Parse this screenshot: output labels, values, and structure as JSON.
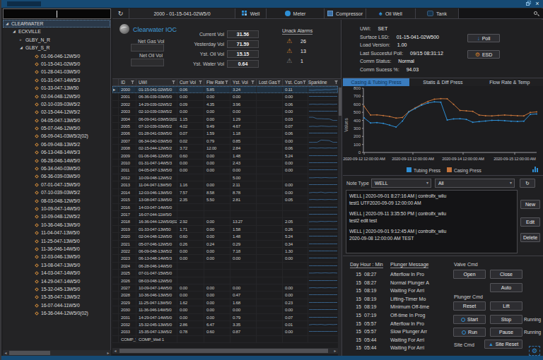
{
  "titlebar": {
    "restore": "restore",
    "close": "×"
  },
  "toolbar": {
    "well_selector": "2000 - 01-15-041-02W5/0",
    "tabs": [
      {
        "label": "Well",
        "icon": "grid-icon"
      },
      {
        "label": "Meter",
        "icon": "circle-icon"
      },
      {
        "label": "Compressor",
        "icon": "compressor-icon"
      },
      {
        "label": "Oil Well",
        "icon": "spade-icon"
      },
      {
        "label": "Tank",
        "icon": "tank-icon"
      }
    ]
  },
  "sidebar": {
    "filter_value": "",
    "root": "CLEARWATER",
    "region": "ECKVILLE",
    "groups": [
      {
        "label": "GLBY_N_R",
        "expanded": false
      },
      {
        "label": "GLBY_S_R",
        "expanded": true
      }
    ],
    "wells": [
      "01-06-046-12W5/0",
      "01-15-041-02W5/0",
      "01-28-041-03W5/0",
      "01-31-047-14W5/3",
      "01-33-047-13W50",
      "02-04-048-12W5/0",
      "02-10-039-03W5/2",
      "02-15-044-12W5/2",
      "04-05-047-13W5/0",
      "05-07-046-12W5/0",
      "06-09-041-03W5/2(02)",
      "06-09-048-13W5/2",
      "06-13-048-14W5/3",
      "06-28-046-14W5/0",
      "06-34-040-03W5/0",
      "06-36-039-03W5/0",
      "07-01-047-15W5/0",
      "07-10-039-03W5/2",
      "08-03-048-12W5/0",
      "10-09-047-14W5/0",
      "10-09-048-12W5/2",
      "10-36-046-13W5/0",
      "11-04-047-13W5/0",
      "11-25-047-13W5/0",
      "11-36-046-14W5/0",
      "12-03-046-13W5/0",
      "13-08-047-13W5/0",
      "14-03-047-14W5/0",
      "14-29-047-14W5/0",
      "15-32-045-13W5/0",
      "15-35-047-13W5/2",
      "16-07-044-11W5/0",
      "16-36-044-12W5/0(02)"
    ]
  },
  "ioc_panel": {
    "brand": "Clearwater IOC",
    "left_fields": [
      {
        "label": "Net Gas Vol",
        "value": ""
      },
      {
        "label": "Net Oil Vol",
        "value": ""
      }
    ],
    "right_fields": [
      {
        "label": "Current Vol",
        "value": "31.56"
      },
      {
        "label": "Yesterday Vol",
        "value": "71.59"
      },
      {
        "label": "Yst. Oil Vol",
        "value": "15.15"
      },
      {
        "label": "Yst. Water Vol",
        "value": "0.64"
      }
    ],
    "alarms": {
      "title": "Unack Alarms",
      "rows": [
        {
          "severity": "high",
          "count": "26"
        },
        {
          "severity": "high",
          "count": "13"
        },
        {
          "severity": "low",
          "count": "1"
        }
      ]
    }
  },
  "well_info": {
    "rows": [
      {
        "label": "UWI:",
        "value": "SET"
      },
      {
        "label": "Surface LSD:",
        "value": "01-15-041-02W500"
      },
      {
        "label": "Load Version:",
        "value": "1.00"
      },
      {
        "label": "Last Succesful Poll:",
        "value": "09/15 08:31:12"
      },
      {
        "label": "Comm Status:",
        "value": "Normal"
      },
      {
        "label": "Comm Sucess %:",
        "value": "94.03"
      }
    ],
    "poll_label": "Poll",
    "esd_label": "ESD"
  },
  "grid": {
    "columns": [
      "",
      "ID",
      "UWI",
      "Curr Vol",
      "Flw Rate",
      "Yst. Vol",
      "Lost Gas",
      "Yst. Cond",
      "Sparkline"
    ],
    "rows": [
      {
        "id": "2000",
        "uwi": "01-15-041-02W5/0",
        "curr": "0.06",
        "flw": "5.85",
        "yst": "3.24",
        "lost": "",
        "cond": "0.11",
        "selected": true,
        "spark": [
          0.35,
          0.3,
          0.4,
          0.35,
          0.45,
          0.4,
          0.5,
          0.55
        ]
      },
      {
        "id": "2001",
        "uwi": "06-36-039-03W5/0",
        "curr": "0.00",
        "flw": "0.00",
        "yst": "0.00",
        "lost": "",
        "cond": "0.00",
        "spark": [
          0.5,
          0.5,
          0.5,
          0.5,
          0.5,
          0.5,
          0.5,
          0.5
        ]
      },
      {
        "id": "2002",
        "uwi": "14-29-039-02W5/2",
        "curr": "0.09",
        "flw": "4.35",
        "yst": "3.96",
        "lost": "",
        "cond": "0.06",
        "spark": [
          0.45,
          0.5,
          0.45,
          0.5,
          0.45,
          0.5,
          0.45,
          0.5
        ]
      },
      {
        "id": "2003",
        "uwi": "02-10-039-03W5/2",
        "curr": "0.00",
        "flw": "0.00",
        "yst": "0.00",
        "lost": "",
        "cond": "0.00",
        "spark": [
          0.5,
          0.5,
          0.5,
          0.5,
          0.5,
          0.5,
          0.5,
          0.5
        ]
      },
      {
        "id": "2004",
        "uwi": "06-09-041-03W5/2(02)",
        "curr": "1.15",
        "flw": "0.00",
        "yst": "1.29",
        "lost": "",
        "cond": "0.03",
        "spark": [
          0.85,
          0.85,
          0.55,
          0.55,
          0.5,
          0.5,
          0.2,
          0.2
        ]
      },
      {
        "id": "2005",
        "uwi": "07-10-039-03W5/2",
        "curr": "4.02",
        "flw": "9.49",
        "yst": "4.67",
        "lost": "",
        "cond": "0.07",
        "spark": [
          0.4,
          0.45,
          0.4,
          0.5,
          0.45,
          0.4,
          0.45,
          0.4
        ]
      },
      {
        "id": "2006",
        "uwi": "01-28-041-03W5/0",
        "curr": "0.07",
        "flw": "1.59",
        "yst": "1.18",
        "lost": "",
        "cond": "0.06",
        "spark": [
          0.5,
          0.5,
          0.5,
          0.5,
          0.5,
          0.5,
          0.5,
          0.5
        ]
      },
      {
        "id": "2007",
        "uwi": "06-34-040-03W5/0",
        "curr": "0.02",
        "flw": "0.79",
        "yst": "0.85",
        "lost": "",
        "cond": "0.00",
        "spark": [
          0.2,
          0.2,
          0.2,
          0.65,
          0.6,
          0.55,
          0.2,
          0.2
        ]
      },
      {
        "id": "2008",
        "uwi": "02-15-044-12W5/2",
        "curr": "3.72",
        "flw": "12.00",
        "yst": "2.84",
        "lost": "",
        "cond": "0.06",
        "spark": [
          0.45,
          0.5,
          0.45,
          0.5,
          0.45,
          0.5,
          0.45,
          0.5
        ]
      },
      {
        "id": "2009",
        "uwi": "01-06-046-12W5/0",
        "curr": "0.60",
        "flw": "0.00",
        "yst": "1.48",
        "lost": "",
        "cond": "5.24",
        "spark": [
          0.5,
          0.5,
          0.5,
          0.5,
          0.5,
          0.5,
          0.5,
          0.5
        ]
      },
      {
        "id": "2010",
        "uwi": "01-31-047-14W5/3",
        "curr": "0.00",
        "flw": "0.00",
        "yst": "2.43",
        "lost": "",
        "cond": "0.00",
        "spark": [
          0.5,
          0.5,
          0.5,
          0.5,
          0.5,
          0.5,
          0.5,
          0.5
        ]
      },
      {
        "id": "2011",
        "uwi": "04-05-047-13W5/0",
        "curr": "0.00",
        "flw": "0.00",
        "yst": "0.00",
        "lost": "",
        "cond": "0.00",
        "spark": [
          0.5,
          0.5,
          0.5,
          0.5,
          0.5,
          0.5,
          0.5,
          0.5
        ]
      },
      {
        "id": "2012",
        "uwi": "10-09-048-12W5/2",
        "curr": "",
        "flw": "",
        "yst": "5.00",
        "lost": "",
        "cond": "",
        "spark": [
          0.45,
          0.45,
          0.5,
          0.45,
          0.5,
          0.45,
          0.45,
          0.5
        ]
      },
      {
        "id": "2013",
        "uwi": "11-04-047-13W5/0",
        "curr": "1.16",
        "flw": "0.00",
        "yst": "2.11",
        "lost": "",
        "cond": "0.00",
        "spark": [
          0.5,
          0.5,
          0.5,
          0.5,
          0.5,
          0.5,
          0.5,
          0.5
        ]
      },
      {
        "id": "2014",
        "uwi": "12-03-046-13W5/0",
        "curr": "7.57",
        "flw": "8.58",
        "yst": "8.78",
        "lost": "",
        "cond": "0.00",
        "spark": [
          0.4,
          0.5,
          0.45,
          0.55,
          0.4,
          0.5,
          0.45,
          0.5
        ]
      },
      {
        "id": "2015",
        "uwi": "13-08-047-13W5/0",
        "curr": "2.35",
        "flw": "5.50",
        "yst": "2.81",
        "lost": "",
        "cond": "0.05",
        "spark": [
          0.45,
          0.5,
          0.45,
          0.5,
          0.45,
          0.5,
          0.45,
          0.5
        ]
      },
      {
        "id": "2016",
        "uwi": "14-03-047-14W5/0",
        "curr": "",
        "flw": "",
        "yst": "",
        "lost": "",
        "cond": "",
        "spark": [
          0.5,
          0.5,
          0.5,
          0.5,
          0.5,
          0.5,
          0.5,
          0.5
        ]
      },
      {
        "id": "2017",
        "uwi": "16-07-044-11W5/0",
        "curr": "",
        "flw": "",
        "yst": "",
        "lost": "",
        "cond": "",
        "spark": [
          0.5,
          0.5,
          0.5,
          0.5,
          0.5,
          0.5,
          0.5,
          0.5
        ]
      },
      {
        "id": "2018",
        "uwi": "16-36-044-12W5/0(02)",
        "curr": "2.92",
        "flw": "0.00",
        "yst": "13.27",
        "lost": "",
        "cond": "2.05",
        "spark": [
          0.4,
          0.45,
          0.4,
          0.5,
          0.45,
          0.5,
          0.45,
          0.5
        ]
      },
      {
        "id": "2019",
        "uwi": "01-33-047-13W50",
        "curr": "1.71",
        "flw": "0.00",
        "yst": "1.58",
        "lost": "",
        "cond": "0.26",
        "spark": [
          0.5,
          0.5,
          0.5,
          0.5,
          0.5,
          0.5,
          0.5,
          0.5
        ]
      },
      {
        "id": "2020",
        "uwi": "02-04-048-12W5/0",
        "curr": "0.60",
        "flw": "0.00",
        "yst": "1.48",
        "lost": "",
        "cond": "5.24",
        "spark": [
          0.5,
          0.5,
          0.5,
          0.5,
          0.5,
          0.5,
          0.5,
          0.5
        ]
      },
      {
        "id": "2021",
        "uwi": "05-07-046-12W5/0",
        "curr": "0.26",
        "flw": "0.24",
        "yst": "0.29",
        "lost": "",
        "cond": "0.34",
        "spark": [
          0.5,
          0.5,
          0.5,
          0.5,
          0.5,
          0.5,
          0.5,
          0.5
        ]
      },
      {
        "id": "2022",
        "uwi": "06-09-048-13W5/2",
        "curr": "0.00",
        "flw": "0.00",
        "yst": "7.18",
        "lost": "",
        "cond": "1.30",
        "spark": [
          0.5,
          0.5,
          0.5,
          0.5,
          0.5,
          0.5,
          0.5,
          0.5
        ]
      },
      {
        "id": "2023",
        "uwi": "06-13-048-14W5/3",
        "curr": "0.00",
        "flw": "0.00",
        "yst": "0.00",
        "lost": "",
        "cond": "0.00",
        "spark": [
          0.5,
          0.5,
          0.5,
          0.5,
          0.5,
          0.5,
          0.5,
          0.5
        ]
      },
      {
        "id": "2024",
        "uwi": "06-28-046-14W5/0",
        "curr": "",
        "flw": "",
        "yst": "",
        "lost": "",
        "cond": "",
        "spark": [
          0.5,
          0.5,
          0.5,
          0.5,
          0.5,
          0.5,
          0.5,
          0.5
        ]
      },
      {
        "id": "2025",
        "uwi": "07-01-047-15W5/0",
        "curr": "",
        "flw": "",
        "yst": "",
        "lost": "",
        "cond": "",
        "spark": [
          0.45,
          0.45,
          0.5,
          0.45,
          0.5,
          0.45,
          0.5,
          0.45
        ]
      },
      {
        "id": "2026",
        "uwi": "08-03-048-12W5/0",
        "curr": "",
        "flw": "",
        "yst": "",
        "lost": "",
        "cond": "",
        "spark": [
          0.5,
          0.5,
          0.5,
          0.5,
          0.5,
          0.5,
          0.5,
          0.5
        ]
      },
      {
        "id": "2027",
        "uwi": "10-09-047-14W5/0",
        "curr": "0.00",
        "flw": "0.00",
        "yst": "0.00",
        "lost": "",
        "cond": "0.00",
        "spark": [
          0.45,
          0.5,
          0.45,
          0.5,
          0.45,
          0.5,
          0.45,
          0.5
        ]
      },
      {
        "id": "2028",
        "uwi": "10-36-046-13W5/0",
        "curr": "0.00",
        "flw": "0.00",
        "yst": "0.47",
        "lost": "",
        "cond": "0.00",
        "spark": [
          0.5,
          0.5,
          0.5,
          0.5,
          0.5,
          0.5,
          0.5,
          0.5
        ]
      },
      {
        "id": "2029",
        "uwi": "11-25-047-13W5/0",
        "curr": "1.62",
        "flw": "0.00",
        "yst": "1.68",
        "lost": "",
        "cond": "0.23",
        "spark": [
          0.5,
          0.5,
          0.5,
          0.5,
          0.5,
          0.5,
          0.5,
          0.5
        ]
      },
      {
        "id": "2030",
        "uwi": "11-36-046-14W5/0",
        "curr": "0.00",
        "flw": "0.00",
        "yst": "0.00",
        "lost": "",
        "cond": "0.00",
        "spark": [
          0.5,
          0.5,
          0.5,
          0.5,
          0.5,
          0.5,
          0.5,
          0.5
        ]
      },
      {
        "id": "2031",
        "uwi": "14-29-047-14W5/0",
        "curr": "0.00",
        "flw": "0.00",
        "yst": "0.79",
        "lost": "",
        "cond": "0.07",
        "spark": [
          0.5,
          0.5,
          0.5,
          0.5,
          0.5,
          0.5,
          0.5,
          0.5
        ]
      },
      {
        "id": "2032",
        "uwi": "15-32-045-13W5/0",
        "curr": "2.86",
        "flw": "6.47",
        "yst": "3.35",
        "lost": "",
        "cond": "0.01",
        "spark": [
          0.4,
          0.5,
          0.45,
          0.5,
          0.4,
          0.5,
          0.45,
          0.5
        ]
      },
      {
        "id": "2033",
        "uwi": "15-35-047-13W5/2",
        "curr": "0.78",
        "flw": "0.60",
        "yst": "0.87",
        "lost": "",
        "cond": "0.00",
        "spark": [
          0.5,
          0.5,
          0.5,
          0.5,
          0.5,
          0.5,
          0.5,
          0.5
        ]
      }
    ],
    "comp_row": {
      "id": "COMP_W",
      "uwi": "COMP_Well 1"
    }
  },
  "chart_data": {
    "type": "line",
    "tabs": [
      "Casing & Tubing Press",
      "Statis & Diff Press",
      "Flow Rate & Temp"
    ],
    "active_tab": "Casing & Tubing Press",
    "ylabel": "Values",
    "ylim": [
      0,
      800
    ],
    "yticks": [
      0,
      100,
      200,
      300,
      400,
      500,
      600,
      700,
      800
    ],
    "x_labels": [
      "2020-09-12 12:00:00 AM",
      "2020-09-13 12:00:00 AM",
      "2020-09-14 12:00:00 AM",
      "2020-09-15 12:00:00 AM"
    ],
    "legend_position": "bottom",
    "series": [
      {
        "name": "Tubing Press",
        "color": "#2e8fd6",
        "values": [
          430,
          368,
          372,
          362,
          340,
          316,
          392,
          505,
          548,
          588,
          616,
          630,
          626,
          404,
          418,
          420,
          412,
          376,
          384,
          392,
          400,
          400,
          396,
          390,
          386,
          390,
          474,
          480
        ]
      },
      {
        "name": "Casing Press",
        "color": "#c4733a",
        "values": [
          575,
          466,
          468,
          460,
          448,
          428,
          436,
          510,
          556,
          600,
          636,
          664,
          670,
          668,
          600,
          524,
          518,
          512,
          466,
          458,
          456,
          462,
          466,
          462,
          458,
          456,
          498,
          505
        ]
      }
    ]
  },
  "notes": {
    "note_type_label": "Note Type",
    "note_type_value": "WELL",
    "filter_value": "All",
    "items": [
      {
        "header": "WELL | 2020-09-01 8:27:16 AM | controlfx_wliu",
        "body": "test1 UTF2020-09-09 12:00:00 AM"
      },
      {
        "header": "WELL | 2020-09-11 3:35:50 PM | controlfx_wliu",
        "body": "test2 edit test"
      },
      {
        "header": "WELL | 2020-09-01 9:12:45 AM | controlfx_wliu",
        "body": "2020-09-08 12:00:00 AM TEST"
      }
    ],
    "new_label": "New",
    "edit_label": "Edit",
    "delete_label": "Delete"
  },
  "plunger": {
    "col1": "Day Hour : Min",
    "col2": "Plunger Message",
    "rows": [
      [
        "15",
        "08:27",
        "Afterflow In Pro"
      ],
      [
        "15",
        "08:27",
        "Normal Plunger A"
      ],
      [
        "15",
        "08:19",
        "Waiting For Arri"
      ],
      [
        "15",
        "08:19",
        "Lifting-Timer Mo"
      ],
      [
        "15",
        "08:19",
        "Minimum Off-time"
      ],
      [
        "15",
        "07:19",
        "Off-time In Prog"
      ],
      [
        "15",
        "05:57",
        "Afterflow In Pro"
      ],
      [
        "15",
        "05:57",
        "Slow Plunger Arr"
      ],
      [
        "15",
        "05:44",
        "Waiting For Arri"
      ],
      [
        "15",
        "05:44",
        "Waiting For Arri"
      ]
    ],
    "valve_label": "Valve Cmd",
    "open_label": "Open",
    "close_label": "Close",
    "auto_label": "Auto",
    "plunger_label": "Plunger Cmd",
    "reset_label": "Reset",
    "lift_label": "Lift",
    "start_label": "Start",
    "stop_label": "Stop",
    "run_label": "Run",
    "pause_label": "Pause",
    "running1": "Running",
    "running2": "Running",
    "site_label": "Site Cmd",
    "site_reset_label": "Site Reset"
  }
}
